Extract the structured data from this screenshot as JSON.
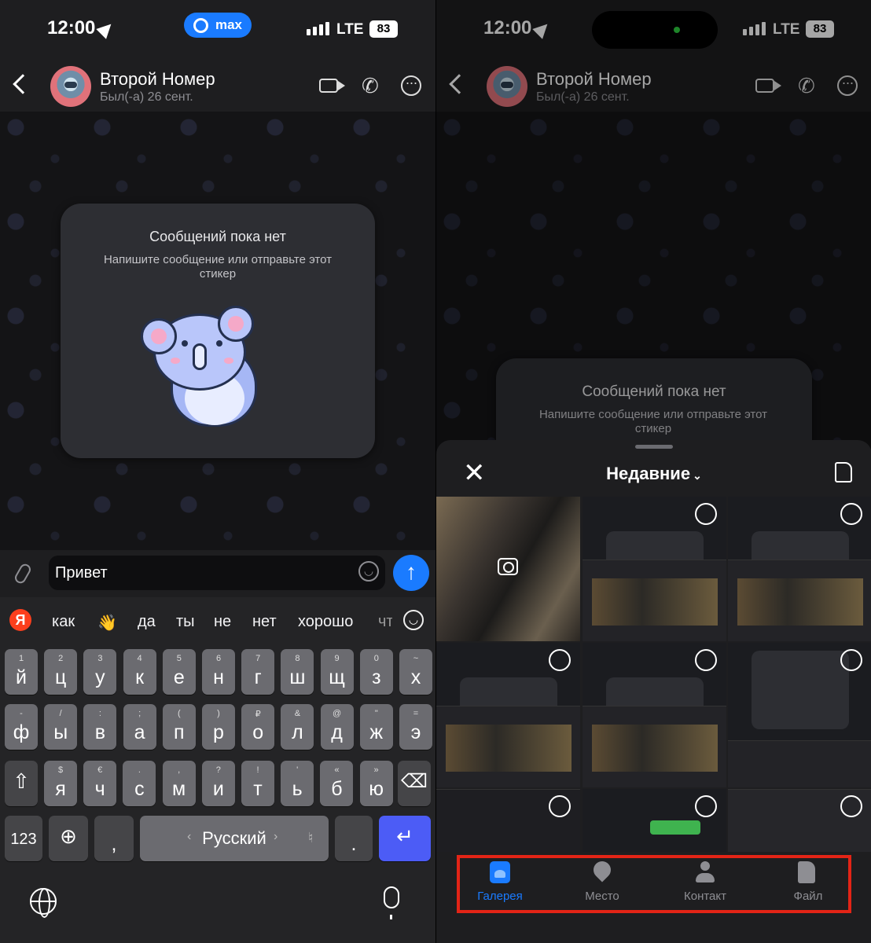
{
  "left": {
    "status": {
      "time": "12:00",
      "network": "LTE",
      "battery": "83",
      "app_pill": "max"
    },
    "header": {
      "name": "Второй Номер",
      "last_seen": "Был(-а) 26 сент."
    },
    "empty": {
      "title": "Сообщений пока нет",
      "subtitle": "Напишите сообщение или отправьте этот стикер"
    },
    "composer": {
      "value": "Привет"
    },
    "suggestions": [
      "как",
      "👋",
      "да",
      "ты",
      "не",
      "нет",
      "хорошо",
      "чт"
    ],
    "keyboard": {
      "row1": [
        [
          "й",
          "1"
        ],
        [
          "ц",
          "2"
        ],
        [
          "у",
          "3"
        ],
        [
          "к",
          "4"
        ],
        [
          "е",
          "5"
        ],
        [
          "н",
          "6"
        ],
        [
          "г",
          "7"
        ],
        [
          "ш",
          "8"
        ],
        [
          "щ",
          "9"
        ],
        [
          "з",
          "0"
        ],
        [
          "х",
          "~"
        ]
      ],
      "row2": [
        [
          "ф",
          "-"
        ],
        [
          "ы",
          "/"
        ],
        [
          "в",
          ":"
        ],
        [
          "а",
          ";"
        ],
        [
          "п",
          "("
        ],
        [
          "р",
          ")"
        ],
        [
          "о",
          "₽"
        ],
        [
          "л",
          "&"
        ],
        [
          "д",
          "@"
        ],
        [
          "ж",
          "\""
        ],
        [
          "э",
          "="
        ]
      ],
      "row3": [
        [
          "я",
          "$"
        ],
        [
          "ч",
          "€"
        ],
        [
          "с",
          "."
        ],
        [
          "м",
          ","
        ],
        [
          "и",
          "?"
        ],
        [
          "т",
          "!"
        ],
        [
          "ь",
          "'"
        ],
        [
          "б",
          "«"
        ],
        [
          "ю",
          "»"
        ]
      ],
      "numbers_label": "123",
      "comma": ",",
      "space_label": "Русский",
      "period": "."
    }
  },
  "right": {
    "status": {
      "time": "12:00",
      "network": "LTE",
      "battery": "83"
    },
    "header": {
      "name": "Второй Номер",
      "last_seen": "Был(-а) 26 сент."
    },
    "empty": {
      "title": "Сообщений пока нет",
      "subtitle": "Напишите сообщение или отправьте этот стикер"
    },
    "sheet": {
      "title": "Недавние"
    },
    "tabs": [
      {
        "label": "Галерея",
        "icon": "gallery-icon",
        "active": true
      },
      {
        "label": "Место",
        "icon": "location-pin-icon",
        "active": false
      },
      {
        "label": "Контакт",
        "icon": "contact-icon",
        "active": false
      },
      {
        "label": "Файл",
        "icon": "file-icon",
        "active": false
      }
    ]
  },
  "colors": {
    "accent": "#1a7bff",
    "highlight": "#e32416",
    "background": "#141416"
  }
}
